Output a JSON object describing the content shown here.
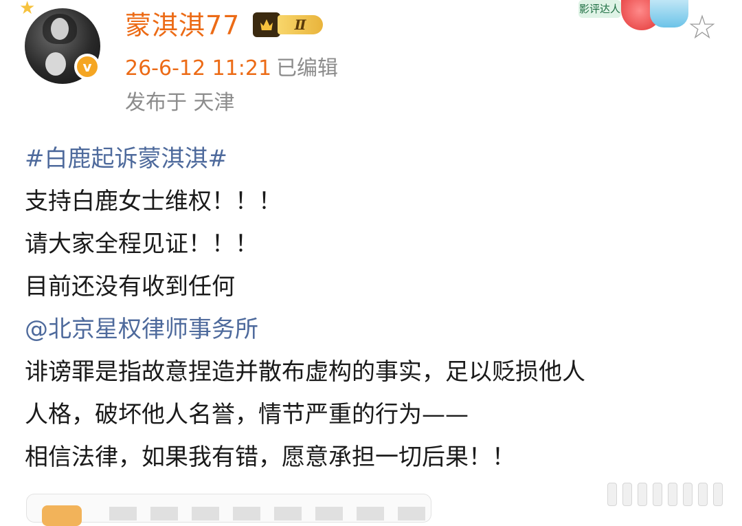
{
  "profile": {
    "username": "蒙淇淇77",
    "level_badge": "Ⅱ",
    "verified_mark": "v",
    "timestamp": "26-6-12 11:21",
    "edited_label": "已编辑",
    "location": "发布于 天津"
  },
  "decoration": {
    "title_badge": "影评达人"
  },
  "icons": {
    "favorite": "star-outline-icon"
  },
  "post": {
    "hashtag": "#白鹿起诉蒙淇淇#",
    "line1": "支持白鹿女士维权！！！",
    "line2": "请大家全程见证！！！",
    "line3": "目前还没有收到任何",
    "mention": "@北京星权律师事务所",
    "line4": "诽谤罪是指故意捏造并散布虚构的事实，足以贬损他人",
    "line5": "人格，破坏他人名誉，情节严重的行为——",
    "line6": "相信法律，如果我有错，愿意承担一切后果！！"
  },
  "colors": {
    "username": "#ec6b16",
    "link": "#4e6a9c",
    "meta": "#8c8c8c",
    "body_text": "#1a1a1a"
  }
}
